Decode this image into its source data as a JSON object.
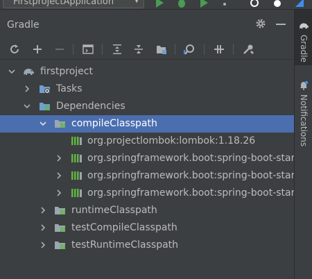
{
  "app": {
    "run_config": "FirstprojectApplication"
  },
  "panel": {
    "title": "Gradle"
  },
  "toolbar": {
    "buttons": [
      "reload-icon",
      "add-icon",
      "remove-icon",
      "execute-task-icon",
      "expand-all-icon",
      "collapse-all-icon",
      "group-modules-icon",
      "analyze-dependencies-icon",
      "toggle-offline-icon",
      "build-tool-settings-icon"
    ]
  },
  "tree": {
    "root": "firstproject",
    "tasks": "Tasks",
    "dependencies": "Dependencies",
    "compile_classpath": "compileClasspath",
    "deps": [
      "org.projectlombok:lombok:1.18.26",
      "org.springframework.boot:spring-boot-starte",
      "org.springframework.boot:spring-boot-starte",
      "org.springframework.boot:spring-boot-starte"
    ],
    "runtime_classpath": "runtimeClasspath",
    "test_compile_classpath": "testCompileClasspath",
    "test_runtime_classpath": "testRuntimeClasspath"
  },
  "side_tabs": {
    "gradle": "Gradle",
    "notifications": "Notifications"
  },
  "colors": {
    "selection": "#4b6eaf",
    "background": "#3c3f41",
    "run_green": "#499c54",
    "dep_green": "#62b543",
    "folder_blue": "#6f9fcf"
  }
}
